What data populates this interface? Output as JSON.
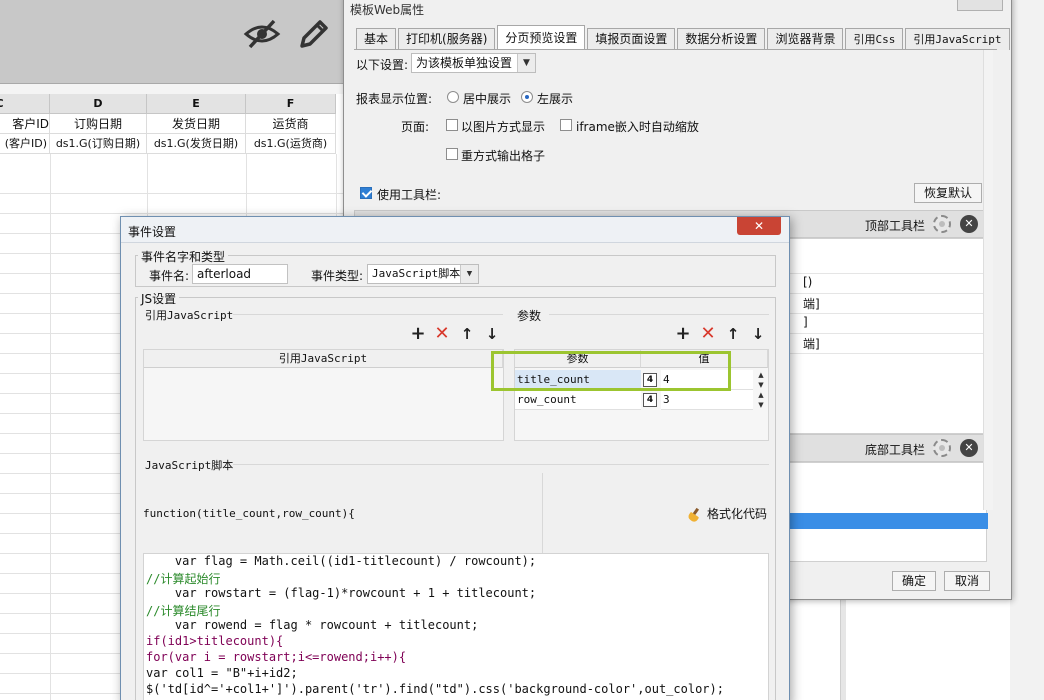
{
  "background": {
    "columns": [
      {
        "letter": "C",
        "header": "客户ID",
        "formula": "(客户ID)"
      },
      {
        "letter": "D",
        "header": "订购日期",
        "formula": "ds1.G(订购日期)"
      },
      {
        "letter": "E",
        "header": "发货日期",
        "formula": "ds1.G(发货日期)"
      },
      {
        "letter": "F",
        "header": "运货商",
        "formula": "ds1.G(运货商)"
      }
    ],
    "toolbar_icons": [
      "eye-slash-icon",
      "pencil-icon"
    ]
  },
  "web_props": {
    "title": "模板Web属性",
    "tabs": [
      "基本",
      "打印机(服务器)",
      "分页预览设置",
      "填报页面设置",
      "数据分析设置",
      "浏览器背景",
      "引用Css",
      "引用JavaScript"
    ],
    "active_tab": 2,
    "settings_label": "以下设置:",
    "settings_value": "为该模板单独设置",
    "position_label": "报表显示位置:",
    "position_center": "居中展示",
    "position_left": "左展示",
    "page_label": "页面:",
    "opt_image": "以图片方式显示",
    "opt_iframe": "iframe嵌入时自动缩放",
    "opt_repeat": "重方式输出格子",
    "use_toolbar": "使用工具栏:",
    "restore_default": "恢复默认",
    "top_toolbar": "顶部工具栏",
    "bottom_toolbar": "底部工具栏",
    "list_items": [
      "[)",
      "端]",
      "]",
      "端]"
    ],
    "ok": "确定",
    "cancel": "取消"
  },
  "event_dialog": {
    "title": "事件设置",
    "close": "✕",
    "group_name_type": "事件名字和类型",
    "event_name_label": "事件名:",
    "event_name_value": "afterload",
    "event_type_label": "事件类型:",
    "event_type_value": "JavaScript脚本",
    "group_js": "JS设置",
    "ref_js_label": "引用JavaScript",
    "ref_js_column": "引用JavaScript",
    "params_label": "参数",
    "params_col_param": "参数",
    "params_col_value": "值",
    "params": [
      {
        "name": "title_count",
        "type": "4",
        "value": "4"
      },
      {
        "name": "row_count",
        "type": "4",
        "value": "3"
      }
    ],
    "script_label": "JavaScript脚本",
    "signature": "function(title_count,row_count){",
    "format_code": "格式化代码",
    "code_lines": [
      "    var flag = Math.ceil((id1-titlecount) / rowcount);",
      "//计算起始行",
      "    var rowstart = (flag-1)*rowcount + 1 + titlecount;",
      "//计算结尾行",
      "    var rowend = flag * rowcount + titlecount;",
      "if(id1>titlecount){",
      "for(var i = rowstart;i<=rowend;i++){",
      "var col1 = \"B\"+i+id2;",
      "$('td[id^='+col1+']').parent('tr').find(\"td\").css('background-color',out_color);"
    ]
  },
  "colors": {
    "highlight_box": "#9cc530",
    "delete_red": "#d8382b",
    "selection_blue": "#3a8ee6"
  }
}
